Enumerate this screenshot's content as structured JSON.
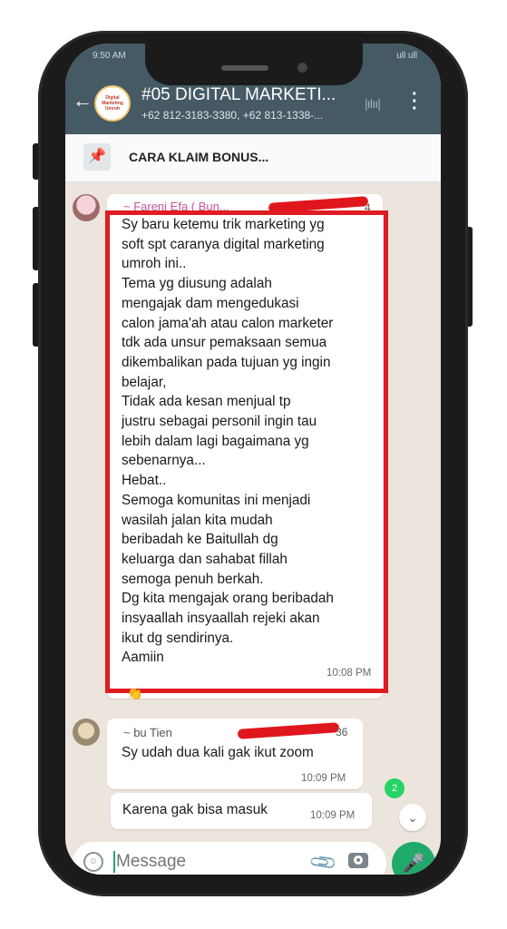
{
  "status": {
    "time": "9:50 AM",
    "right": "ull ull"
  },
  "header": {
    "title": "#05 DIGITAL MARKETI...",
    "subtitle": "+62 812-3183-3380, +62 813-1338-...",
    "avatar_text": "Digital Marketing Umroh"
  },
  "pinned": {
    "text": "CARA KLAIM BONUS..."
  },
  "messages": [
    {
      "sender": "~ Fareni Efa ( Bun...",
      "phone_tail": "4",
      "text": "Sy baru ketemu trik marketing yg\nsoft spt caranya digital marketing\numroh ini..\nTema yg diusung adalah\nmengajak dam mengedukasi\ncalon jama'ah atau calon marketer\ntdk ada unsur pemaksaan semua\ndikembalikan pada tujuan yg ingin\nbelajar,\nTidak ada kesan menjual tp\njustru sebagai personil ingin tau\nlebih dalam lagi bagaimana yg\nsebenarnya...\nHebat..\nSemoga komunitas ini menjadi\nwasilah jalan kita mudah\nberibadah ke Baitullah dg\nkeluarga dan sahabat fillah\nsemoga penuh berkah.\nDg kita mengajak orang beribadah\ninsyaallah insyaallah rejeki akan\nikut dg sendirinya.\nAamiin",
      "time": "10:08 PM",
      "reaction": "👏"
    },
    {
      "sender": "~ bu Tien",
      "phone_tail": "36",
      "text": "Sy udah dua kali gak ikut zoom",
      "time": "10:09 PM"
    },
    {
      "text": "Karena gak bisa masuk",
      "time": "10:09 PM"
    }
  ],
  "unread_count": "2",
  "input": {
    "placeholder": "Message"
  },
  "colors": {
    "header": "#455a64",
    "chat_bg": "#ece5dd",
    "accent": "#1faa6b",
    "highlight": "#e01b22"
  }
}
